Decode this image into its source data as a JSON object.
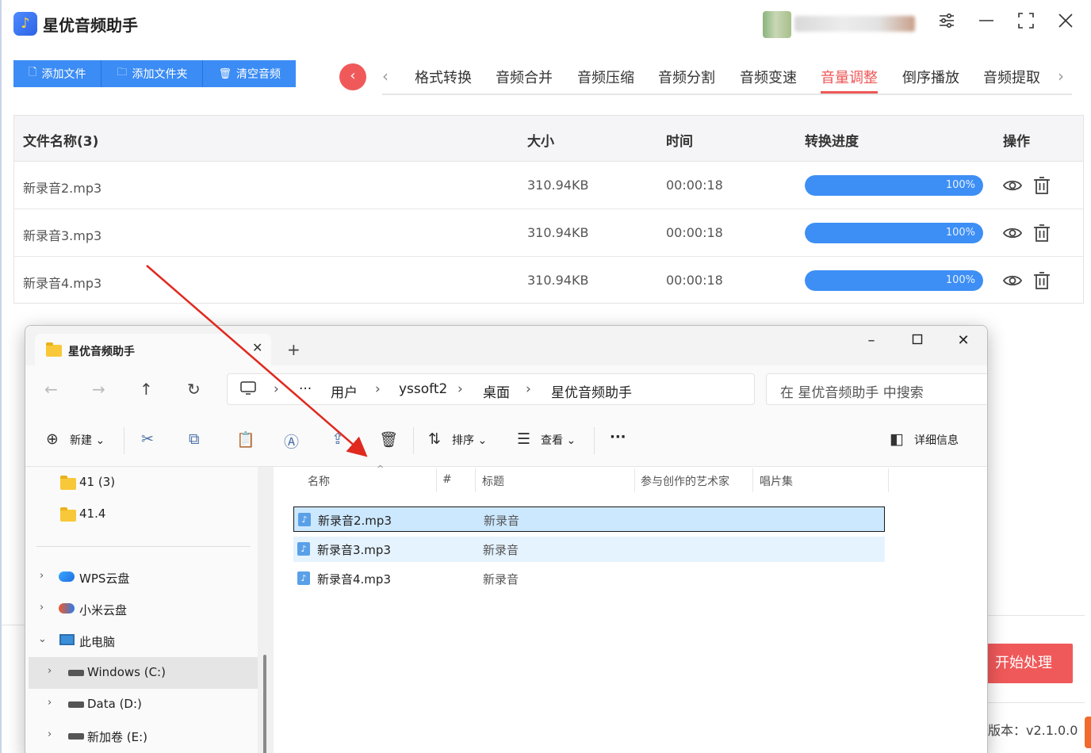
{
  "app": {
    "title": "星优音频助手",
    "toolbar": {
      "add_file": "添加文件",
      "add_folder": "添加文件夹",
      "clear_audio": "清空音频"
    },
    "tabs": [
      "格式转换",
      "音频合并",
      "音频压缩",
      "音频分割",
      "音频变速",
      "音量调整",
      "倒序播放",
      "音频提取"
    ],
    "active_tab": "音量调整",
    "table": {
      "headers": {
        "name": "文件名称(3)",
        "size": "大小",
        "time": "时间",
        "progress": "转换进度",
        "ops": "操作"
      },
      "rows": [
        {
          "name": "新录音2.mp3",
          "size": "310.94KB",
          "time": "00:00:18",
          "progress": 100,
          "progress_label": "100%"
        },
        {
          "name": "新录音3.mp3",
          "size": "310.94KB",
          "time": "00:00:18",
          "progress": 100,
          "progress_label": "100%"
        },
        {
          "name": "新录音4.mp3",
          "size": "310.94KB",
          "time": "00:00:18",
          "progress": 100,
          "progress_label": "100%"
        }
      ]
    },
    "start_button": "开始处理",
    "version": "版本：v2.1.0.0",
    "colors": {
      "accent_blue": "#3b8cf5",
      "accent_red": "#f0595a",
      "progress": "#3d8ff5"
    }
  },
  "explorer": {
    "tab_title": "星优音频助手",
    "breadcrumb": [
      "用户",
      "yssoft2",
      "桌面",
      "星优音频助手"
    ],
    "search_placeholder": "在 星优音频助手 中搜索",
    "commands": {
      "new": "新建",
      "sort": "排序",
      "view": "查看",
      "more": "···",
      "details": "详细信息"
    },
    "sidebar": [
      {
        "label": "41 (3)",
        "icon": "folder-icon"
      },
      {
        "label": "41.4",
        "icon": "folder-icon"
      },
      {
        "label": "WPS云盘",
        "icon": "cloud-icon"
      },
      {
        "label": "小米云盘",
        "icon": "cloud-icon"
      },
      {
        "label": "此电脑",
        "icon": "computer-icon"
      },
      {
        "label": "Windows (C:)",
        "icon": "drive-icon"
      },
      {
        "label": "Data (D:)",
        "icon": "drive-icon"
      },
      {
        "label": "新加卷 (E:)",
        "icon": "drive-icon"
      }
    ],
    "columns": [
      "名称",
      "#",
      "标题",
      "参与创作的艺术家",
      "唱片集"
    ],
    "files": [
      {
        "name": "新录音2.mp3",
        "title": "新录音"
      },
      {
        "name": "新录音3.mp3",
        "title": "新录音"
      },
      {
        "name": "新录音4.mp3",
        "title": "新录音"
      }
    ]
  }
}
